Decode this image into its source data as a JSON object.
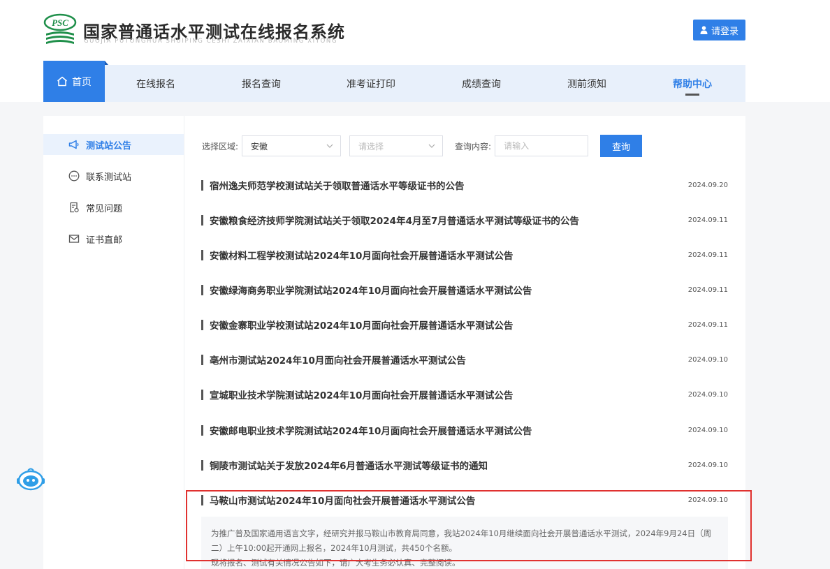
{
  "header": {
    "logo_text": "PSC",
    "title": "国家普通话水平测试在线报名系统",
    "subtitle": "GUOJIA PUTONGHUA SHUIPING CESHI ZAIXIAN BAOMING XITONG",
    "login_label": "请登录"
  },
  "nav": {
    "items": [
      {
        "label": "首页",
        "icon": "home-icon",
        "active": true
      },
      {
        "label": "在线报名"
      },
      {
        "label": "报名查询"
      },
      {
        "label": "准考证打印"
      },
      {
        "label": "成绩查询"
      },
      {
        "label": "测前须知"
      },
      {
        "label": "帮助中心",
        "current": true
      }
    ]
  },
  "sidebar": {
    "items": [
      {
        "label": "测试站公告",
        "icon": "megaphone-icon",
        "active": true
      },
      {
        "label": "联系测试站",
        "icon": "chat-icon"
      },
      {
        "label": "常见问题",
        "icon": "document-icon"
      },
      {
        "label": "证书直邮",
        "icon": "mail-icon"
      }
    ]
  },
  "filter": {
    "region_label": "选择区域:",
    "region_value": "安徽",
    "city_placeholder": "请选择",
    "query_label": "查询内容:",
    "query_placeholder": "请输入",
    "query_button": "查询"
  },
  "news": [
    {
      "title": "宿州逸夫师范学校测试站关于领取普通话水平等级证书的公告",
      "date": "2024.09.20"
    },
    {
      "title": "安徽粮食经济技师学院测试站关于领取2024年4月至7月普通话水平测试等级证书的公告",
      "date": "2024.09.11"
    },
    {
      "title": "安徽材料工程学校测试站2024年10月面向社会开展普通话水平测试公告",
      "date": "2024.09.11"
    },
    {
      "title": "安徽绿海商务职业学院测试站2024年10月面向社会开展普通话水平测试公告",
      "date": "2024.09.11"
    },
    {
      "title": "安徽金寨职业学校测试站2024年10月面向社会开展普通话水平测试公告",
      "date": "2024.09.11"
    },
    {
      "title": "亳州市测试站2024年10月面向社会开展普通话水平测试公告",
      "date": "2024.09.10"
    },
    {
      "title": "宣城职业技术学院测试站2024年10月面向社会开展普通话水平测试公告",
      "date": "2024.09.10"
    },
    {
      "title": "安徽邮电职业技术学院测试站2024年10月面向社会开展普通话水平测试公告",
      "date": "2024.09.10"
    },
    {
      "title": "铜陵市测试站关于发放2024年6月普通话水平测试等级证书的通知",
      "date": "2024.09.10"
    },
    {
      "title": "马鞍山市测试站2024年10月面向社会开展普通话水平测试公告",
      "date": "2024.09.10"
    }
  ],
  "expanded_content": {
    "line1": "为推广普及国家通用语言文字，经研究并报马鞍山市教育局同意，我站2024年10月继续面向社会开展普通话水平测试，2024年9月24日（周",
    "line2": "二）上午10:00起开通网上报名，2024年10月测试，共450个名额。",
    "line3": "现将报名、测试有关情况公告如下，请广大考生务必认真、完整阅读。"
  },
  "colors": {
    "primary": "#2f7fe7",
    "nav_bg": "#e8f0fb",
    "highlight": "#e0312f",
    "logo_green": "#1f8f4a"
  }
}
